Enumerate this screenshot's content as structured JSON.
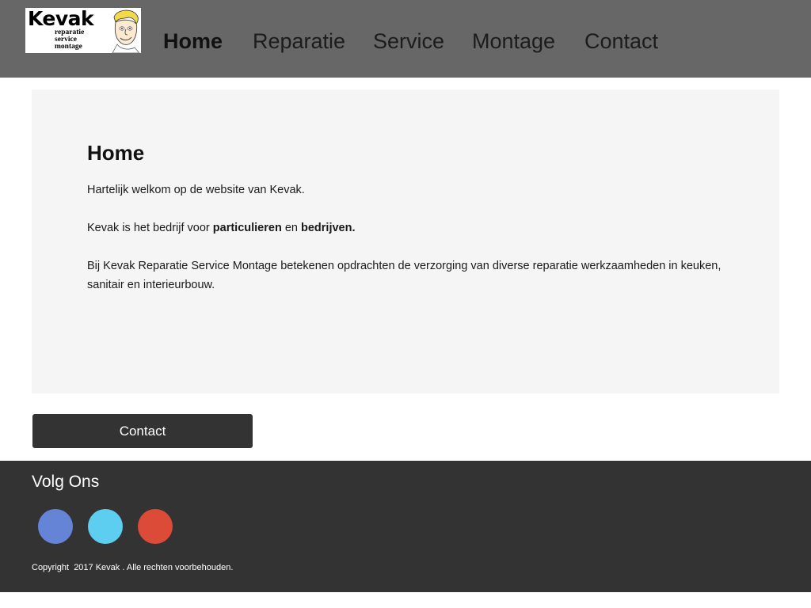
{
  "header": {
    "logo": {
      "name": "Kevak",
      "line1": "reparatie",
      "line2": "service",
      "line3": "montage"
    },
    "nav": [
      {
        "label": "Home",
        "active": true
      },
      {
        "label": "Reparatie",
        "active": false
      },
      {
        "label": "Service",
        "active": false
      },
      {
        "label": "Montage",
        "active": false
      },
      {
        "label": "Contact",
        "active": false
      }
    ]
  },
  "main": {
    "title": "Home",
    "welcome": "Hartelijk welkom op de website van Kevak.",
    "p2_prefix": "Kevak is het bedrijf voor ",
    "p2_bold1": "particulieren",
    "p2_middle": " en ",
    "p2_bold2": "bedrijven.",
    "p3": "Bij Kevak Reparatie Service Montage betekenen opdrachten de verzorging van diverse reparatie werkzaamheden in keuken, sanitair en interieurbouw."
  },
  "contact_button": {
    "label": "Contact"
  },
  "footer": {
    "follow_title": "Volg Ons",
    "social": [
      {
        "icon": "facebook-icon",
        "color": "#6584d6"
      },
      {
        "icon": "twitter-icon",
        "color": "#5dcdf0"
      },
      {
        "icon": "google-plus-icon",
        "color": "#dc4a38"
      }
    ],
    "copyright": "Copyright  2017 Kevak . Alle rechten voorbehouden."
  },
  "colors": {
    "header_bg": "#676767",
    "panel_bg": "#f5f5f5",
    "footer_bg": "#333333",
    "button_bg": "#333333"
  }
}
